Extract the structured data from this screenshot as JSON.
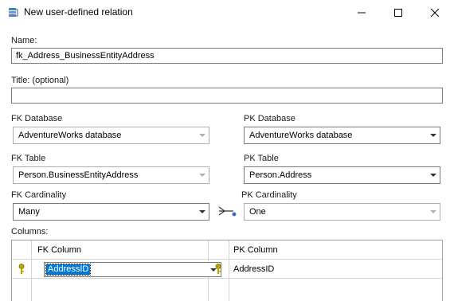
{
  "window": {
    "title": "New user-defined relation",
    "app_icon": "database-relation-icon",
    "controls": [
      "minimize-icon",
      "maximize-icon",
      "close-icon"
    ]
  },
  "form": {
    "name_label": "Name:",
    "name_value": "fk_Address_BusinessEntityAddress",
    "title_label": "Title: (optional)",
    "title_value": "",
    "fk_database_label": "FK Database",
    "fk_database_value": "AdventureWorks database",
    "pk_database_label": "PK Database",
    "pk_database_value": "AdventureWorks database",
    "fk_table_label": "FK Table",
    "fk_table_value": "Person.BusinessEntityAddress",
    "pk_table_label": "PK Table",
    "pk_table_value": "Person.Address",
    "fk_cardinality_label": "FK Cardinality",
    "fk_cardinality_value": "Many",
    "pk_cardinality_label": "PK Cardinality",
    "pk_cardinality_value": "One",
    "columns_label": "Columns:"
  },
  "columns_grid": {
    "headers": [
      "FK Column",
      "PK Column"
    ],
    "rows": [
      {
        "fk_column": "AddressID",
        "pk_column": "AddressID",
        "fk_key_icon": "key-icon",
        "pk_key_icon": "key-icon"
      }
    ]
  },
  "colors": {
    "selection": "#0078d7",
    "key_icon": "#b8a600",
    "border": "#7a7a7a",
    "disabled_border": "#adadad"
  }
}
